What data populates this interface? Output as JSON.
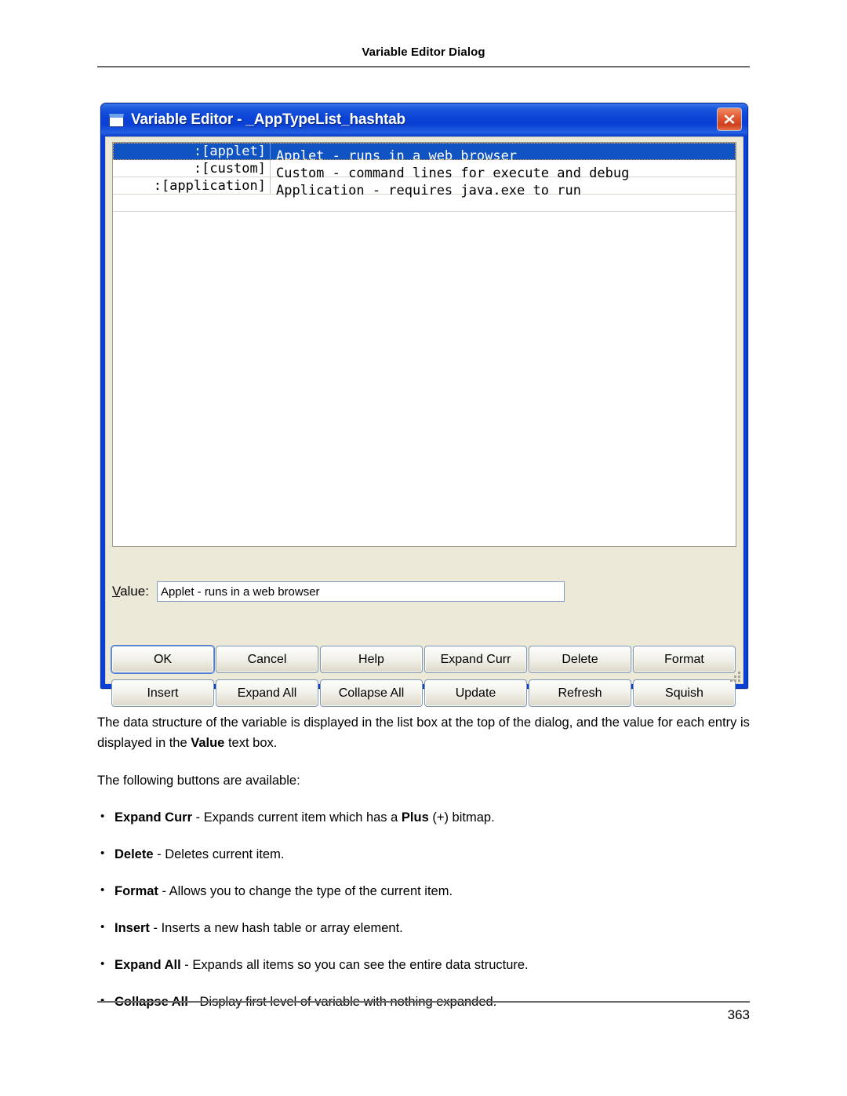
{
  "page": {
    "header_title": "Variable Editor Dialog",
    "page_number": "363"
  },
  "dialog": {
    "title": "Variable Editor - _AppTypeList_hashtab",
    "window_icon": "window-icon",
    "close_icon": "close-icon",
    "listbox": {
      "rows": [
        {
          "key": ":[applet]",
          "value": "Applet - runs in a web browser",
          "selected": true
        },
        {
          "key": ":[custom]",
          "value": "Custom - command lines for execute and debug",
          "selected": false
        },
        {
          "key": ":[application]",
          "value": "Application - requires java.exe to run",
          "selected": false
        }
      ]
    },
    "value_field": {
      "label_accel": "V",
      "label_rest": "alue:",
      "value": "Applet - runs in a web browser",
      "placeholder": ""
    },
    "buttons": [
      {
        "label": "OK",
        "default": true
      },
      {
        "label": "Cancel",
        "default": false
      },
      {
        "label": "Help",
        "default": false
      },
      {
        "label": "Expand Curr",
        "default": false
      },
      {
        "label": "Delete",
        "default": false
      },
      {
        "label": "Format",
        "default": false
      },
      {
        "label": "Insert",
        "default": false
      },
      {
        "label": "Expand All",
        "default": false
      },
      {
        "label": "Collapse All",
        "default": false
      },
      {
        "label": "Update",
        "default": false
      },
      {
        "label": "Refresh",
        "default": false
      },
      {
        "label": "Squish",
        "default": false
      }
    ],
    "resize_grip": "resize-grip-icon"
  },
  "content": {
    "paragraph_1_a": "The data structure of the variable is displayed in the list box at the top of the dialog, and the value for each entry is displayed in the ",
    "paragraph_1_b": "Value",
    "paragraph_1_c": " text box.",
    "paragraph_2": "The following buttons are available:",
    "bullets": [
      {
        "term": "Expand Curr",
        "desc_a": " - Expands current item which has a ",
        "term2": "Plus",
        "desc_b": " (+) bitmap."
      },
      {
        "term": "Delete",
        "desc_a": " - Deletes current item.",
        "term2": "",
        "desc_b": ""
      },
      {
        "term": "Format",
        "desc_a": " - Allows you to change the type of the current item.",
        "term2": "",
        "desc_b": ""
      },
      {
        "term": "Insert",
        "desc_a": " - Inserts a new hash table or array element.",
        "term2": "",
        "desc_b": ""
      },
      {
        "term": "Expand All",
        "desc_a": " - Expands all items so you can see the entire data structure.",
        "term2": "",
        "desc_b": ""
      },
      {
        "term": "Collapse All",
        "desc_a": " - Display first level of variable with nothing expanded.",
        "term2": "",
        "desc_b": ""
      }
    ]
  },
  "colors": {
    "titlebar_blue": "#0a3fd1",
    "selection_blue": "#1054c4",
    "client_bg": "#ece9d8",
    "close_red": "#cf3f1c"
  }
}
